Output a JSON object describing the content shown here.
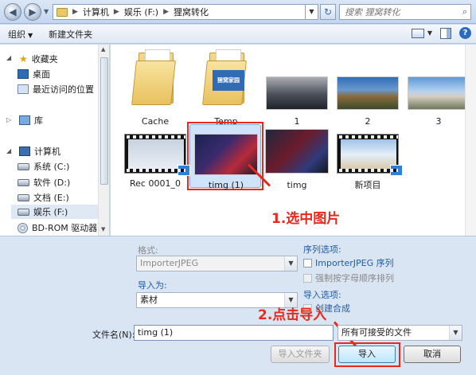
{
  "address": {
    "segments": [
      "计算机",
      "娱乐 (F:)",
      "狸窝转化"
    ],
    "search_placeholder": "搜索 狸窝转化"
  },
  "toolbar": {
    "organize": "组织",
    "new_folder": "新建文件夹"
  },
  "nav": {
    "favorites": "收藏夹",
    "desktop": "桌面",
    "recent": "最近访问的位置",
    "libraries": "库",
    "computer": "计算机",
    "drives": [
      "系统 (C:)",
      "软件 (D:)",
      "文档 (E:)",
      "娱乐 (F:)",
      "BD-ROM 驱动器"
    ]
  },
  "files": [
    {
      "name": "Cache",
      "kind": "folder"
    },
    {
      "name": "Temp",
      "kind": "folder",
      "badge": "狸窝家园"
    },
    {
      "name": "1",
      "kind": "image"
    },
    {
      "name": "2",
      "kind": "image"
    },
    {
      "name": "3",
      "kind": "image"
    },
    {
      "name": "Rec 0001_0",
      "kind": "video"
    },
    {
      "name": "timg (1)",
      "kind": "image",
      "selected": true
    },
    {
      "name": "timg",
      "kind": "image"
    },
    {
      "name": "新项目",
      "kind": "video"
    }
  ],
  "annotations": {
    "step1": "1.选中图片",
    "step2": "2.点击导入"
  },
  "options": {
    "format_label": "格式:",
    "format_value": "ImporterJPEG",
    "import_as_label": "导入为:",
    "import_as_value": "素材",
    "sequence_label": "序列选项:",
    "sequence_checkbox": "ImporterJPEG 序列",
    "force_alpha": "强制按字母顺序排列",
    "import_options_label": "导入选项:",
    "create_comp": "创建合成"
  },
  "filename": {
    "label": "文件名(N):",
    "value": "timg (1)",
    "filter": "所有可接受的文件"
  },
  "buttons": {
    "import_folder": "导入文件夹",
    "import": "导入",
    "cancel": "取消"
  },
  "colors": {
    "annotation_red": "#e8291c",
    "selection_blue": "#cfe3fb"
  }
}
